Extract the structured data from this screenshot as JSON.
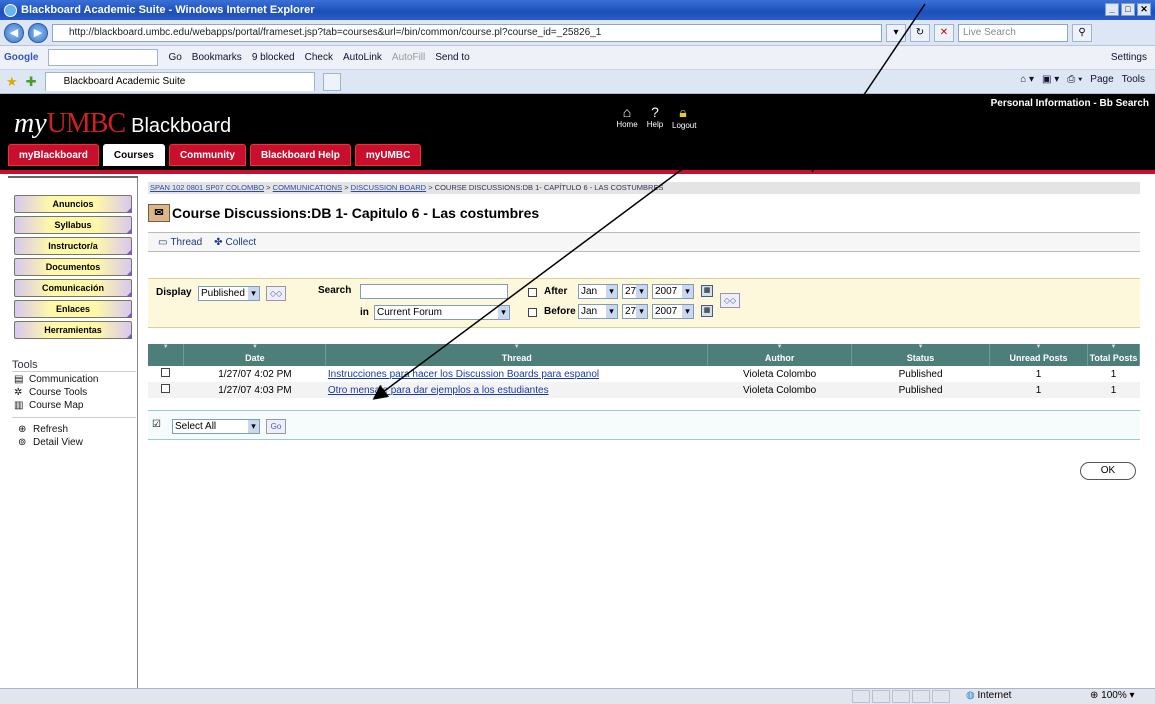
{
  "browser": {
    "title": "Blackboard Academic Suite - Windows Internet Explorer",
    "url": "http://blackboard.umbc.edu/webapps/portal/frameset.jsp?tab=courses&url=/bin/common/course.pl?course_id=_25826_1",
    "live_search_placeholder": "Live Search",
    "google_label": "Google",
    "google_toolbar": [
      "Go",
      "Bookmarks",
      "9 blocked",
      "Check",
      "AutoLink",
      "AutoFill",
      "Send to"
    ],
    "settings": "Settings",
    "tab_title": "Blackboard Academic Suite",
    "cmd": [
      "Page",
      "Tools"
    ]
  },
  "header": {
    "logo_my": "my",
    "logo_umbc": "UMBC",
    "logo_bb": "Blackboard",
    "icons": [
      {
        "label": "Home",
        "icon": "home-icon"
      },
      {
        "label": "Help",
        "icon": "help-icon"
      },
      {
        "label": "Logout",
        "icon": "logout-icon"
      }
    ],
    "top_links": "Personal Information - Bb Search",
    "tabs": [
      "myBlackboard",
      "Courses",
      "Community",
      "Blackboard Help",
      "myUMBC"
    ]
  },
  "leftnav": {
    "buttons": [
      "Anuncios",
      "Syllabus",
      "Instructor/a",
      "Documentos",
      "Comunicación",
      "Enlaces",
      "Herramientas"
    ],
    "tools_title": "Tools",
    "tools": [
      "Communication",
      "Course Tools",
      "Course Map"
    ],
    "tools2": [
      "Refresh",
      "Detail View"
    ]
  },
  "main": {
    "breadcrumb": {
      "links": [
        "SPAN 102 0801 SP07 COLOMBO",
        "COMMUNICATIONS",
        "DISCUSSION BOARD"
      ],
      "current": "COURSE DISCUSSIONS:DB 1- CAPÍTULO 6 - LAS COSTUMBRES"
    },
    "title": "Course Discussions:DB 1- Capitulo 6 - Las costumbres",
    "actions": [
      "Thread",
      "Collect"
    ],
    "filter": {
      "display_label": "Display",
      "display_value": "Published",
      "search_label": "Search",
      "in_label": "in",
      "in_value": "Current Forum",
      "after_label": "After",
      "before_label": "Before",
      "month": "Jan",
      "day": "27",
      "year": "2007"
    },
    "columns": [
      "",
      "Date",
      "Thread",
      "Author",
      "Status",
      "Unread Posts",
      "Total Posts"
    ],
    "rows": [
      {
        "date": "1/27/07 4:02 PM",
        "thread": "Instrucciones para hacer los Discussion Boards para espanol",
        "author": "Violeta Colombo",
        "status": "Published",
        "unread": "1",
        "total": "1"
      },
      {
        "date": "1/27/07 4:03 PM",
        "thread": "Otro mensaje para dar ejemplos a los estudiantes",
        "author": "Violeta Colombo",
        "status": "Published",
        "unread": "1",
        "total": "1"
      }
    ],
    "select_all": "Select All",
    "go": "Go",
    "ok": "OK"
  },
  "statusbar": {
    "zone": "Internet",
    "zoom": "100%"
  }
}
